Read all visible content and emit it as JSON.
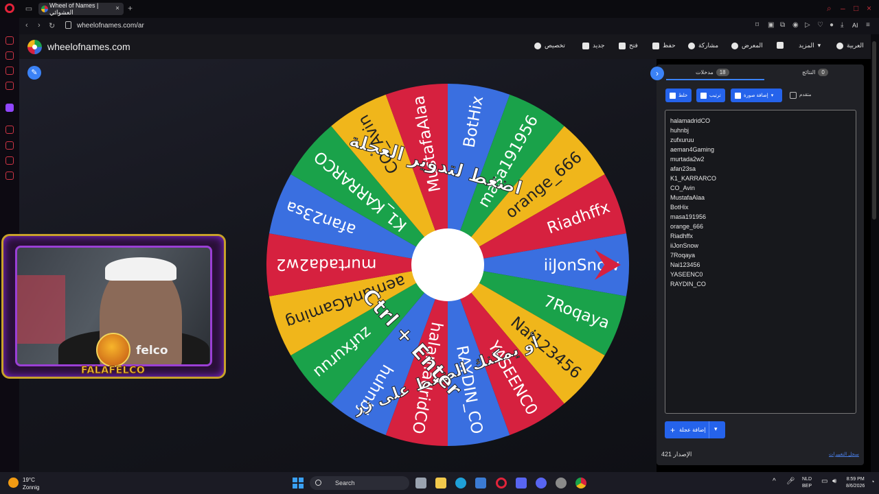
{
  "browser": {
    "tab_title": "Wheel of Names | العشوائي",
    "url": "wheelofnames.com/ar",
    "ai_label": "AI"
  },
  "site": {
    "title": "wheelofnames.com",
    "menu": {
      "customize": "تخصيص",
      "new": "جديد",
      "open": "فتح",
      "save": "حفظ",
      "share": "مشاركة",
      "gallery": "المعرض",
      "more": "المزيد",
      "language": "العربية"
    }
  },
  "wheel": {
    "overlay_top": "اضغط لتدوير العجلة",
    "overlay_bottom_1": "أو يمكنك الضغط على زر",
    "overlay_bottom_2": "Ctrl + Enter",
    "colors": [
      "#d6213f",
      "#3a6fe0",
      "#1aa24a",
      "#f0b61b"
    ],
    "center_color": "#ffffff",
    "pointer_color": "#d6213f"
  },
  "panel": {
    "tab_entries": "مدخلات",
    "tab_entries_count": "18",
    "tab_results": "النتائج",
    "tab_results_count": "0",
    "shuffle": "خلط",
    "sort": "ترتيب",
    "add_image": "إضافة صورة",
    "advanced": "متقدم",
    "entries": [
      "halamadridCO",
      "huhnbj",
      "zufxuruu",
      "aeman4Gaming",
      "murtada2w2",
      "afan23sa",
      "K1_KARRARCO",
      "CO_Avin",
      "MustafaAlaa",
      "BotHix",
      "masa191956",
      "orange_666",
      "Riadhffx",
      "iiJonSnow",
      "7Roqaya",
      "Nai123456",
      "YASEENC0",
      "RAYDIN_CO"
    ],
    "add_wheel": "إضافة عجلة",
    "version_label": "الإصدار",
    "version_number": "421",
    "changelog": "سجل التغييرات"
  },
  "webcam": {
    "shirt_text": "felco",
    "badge_text": "FALAFELCO"
  },
  "taskbar": {
    "temperature": "19°C",
    "weather": "Zonnig",
    "search": "Search",
    "lang_1": "NLD",
    "lang_2": "BEP",
    "time": "8:59 PM",
    "date": "8/6/2026"
  }
}
